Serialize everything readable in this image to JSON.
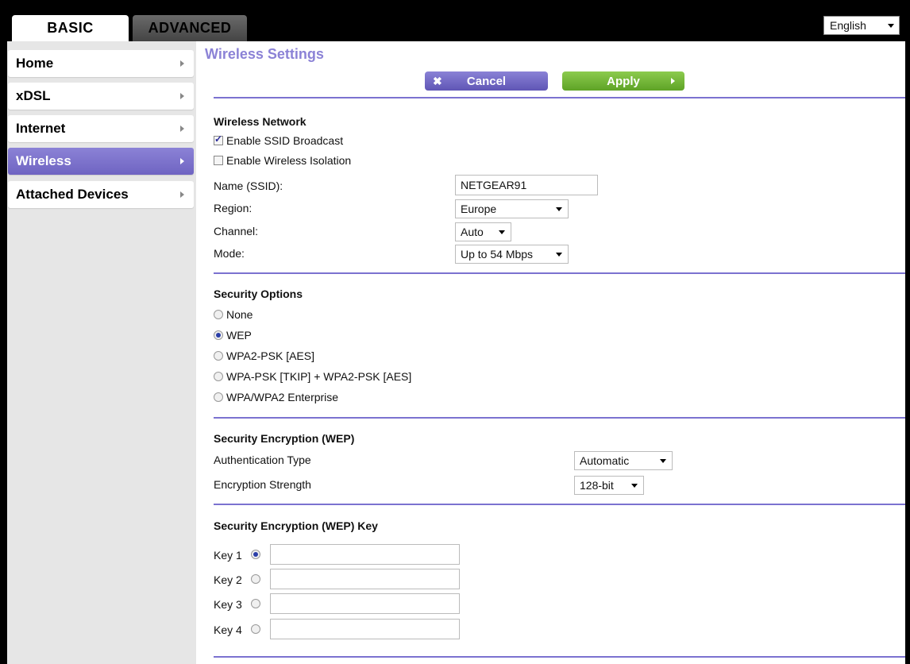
{
  "tabs": {
    "basic": "BASIC",
    "advanced": "ADVANCED"
  },
  "language": {
    "selected": "English"
  },
  "sidebar": {
    "items": [
      {
        "label": "Home"
      },
      {
        "label": "xDSL"
      },
      {
        "label": "Internet"
      },
      {
        "label": "Wireless"
      },
      {
        "label": "Attached Devices"
      }
    ]
  },
  "main": {
    "title": "Wireless Settings",
    "cancel_label": "Cancel",
    "apply_label": "Apply",
    "wireless_network": {
      "heading": "Wireless Network",
      "enable_ssid_label": "Enable SSID Broadcast",
      "enable_ssid_checked": true,
      "enable_isolation_label": "Enable Wireless Isolation",
      "enable_isolation_checked": false,
      "name_label": "Name (SSID):",
      "name_value": "NETGEAR91",
      "region_label": "Region:",
      "region_value": "Europe",
      "channel_label": "Channel:",
      "channel_value": "Auto",
      "mode_label": "Mode:",
      "mode_value": "Up to 54 Mbps"
    },
    "security_options": {
      "heading": "Security Options",
      "options": [
        "None",
        "WEP",
        "WPA2-PSK [AES]",
        "WPA-PSK [TKIP] + WPA2-PSK [AES]",
        "WPA/WPA2 Enterprise"
      ],
      "selected": "WEP"
    },
    "security_encryption": {
      "heading": "Security Encryption (WEP)",
      "auth_label": "Authentication Type",
      "auth_value": "Automatic",
      "strength_label": "Encryption Strength",
      "strength_value": "128-bit"
    },
    "wep_key": {
      "heading": "Security Encryption (WEP) Key",
      "keys": [
        {
          "label": "Key 1",
          "value": ""
        },
        {
          "label": "Key 2",
          "value": ""
        },
        {
          "label": "Key 3",
          "value": ""
        },
        {
          "label": "Key 4",
          "value": ""
        }
      ],
      "selected_key": "Key 1"
    }
  },
  "colors": {
    "accent": "#7b72d0",
    "apply": "#6db534",
    "active_nav": "#7d73cc"
  }
}
